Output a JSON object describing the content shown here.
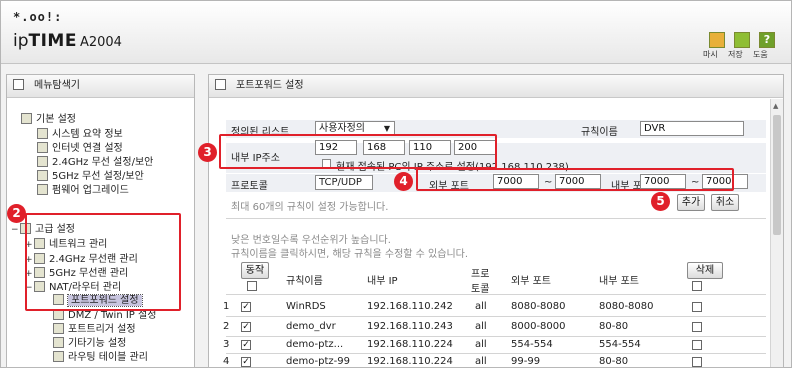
{
  "header": {
    "logo_dots": "*.oo!:",
    "brand_ip": "ip",
    "brand_time": "TIME",
    "model": "A2004",
    "buttons": [
      {
        "label": "마시"
      },
      {
        "label": "저장"
      },
      {
        "label": "도움"
      }
    ]
  },
  "left_panel": {
    "title": "메뉴탐색기",
    "groups": {
      "basic": {
        "label": "기본 설정",
        "items": [
          "시스템 요약 정보",
          "인터넷 연결 설정",
          "2.4GHz 무선 설정/보안",
          "5GHz 무선 설정/보안",
          "펌웨어 업그레이드"
        ]
      },
      "advanced": {
        "label": "고급 설정",
        "items": [
          "네트워크 관리",
          "2.4GHz 무선랜 관리",
          "5GHz 무선랜 관리",
          "NAT/라우터 관리"
        ]
      },
      "nat_items": [
        "포트포워드 설정",
        "DMZ / Twin IP 설정",
        "포트트리거 설정",
        "기타기능 설정",
        "라우팅 테이블 관리"
      ]
    }
  },
  "right_panel": {
    "title": "포트포워드 설정",
    "form": {
      "defined_rule_label": "정의된 리스트",
      "defined_rule_value": "사용자정의",
      "rule_name_label": "규칙이름",
      "rule_name_value": "DVR",
      "internal_ip_label": "내부 IP주소",
      "ip": [
        "192",
        "168",
        "110",
        "200"
      ],
      "current_pc_text": "현재 접속된 PC의 IP 주소로 설정(192.168.110.238)",
      "protocol_label": "프로토콜",
      "protocol_value": "TCP/UDP",
      "ext_port_label": "외부 포트",
      "ext_port_from": "7000",
      "ext_port_to": "7000",
      "int_port_label": "내부 포트",
      "int_port_from": "7000",
      "int_port_to": "7000",
      "tilde": "~",
      "max_rules_note": "최대 60개의 규칙이 설정 가능합니다.",
      "add_button": "추가",
      "cancel_button": "취소"
    },
    "notes": [
      "낮은 번호일수록 우선순위가 높습니다.",
      "규칙이름을 클릭하시면, 해당 규칙을 수정할 수 있습니다."
    ],
    "table": {
      "action_button": "동작",
      "delete_button": "삭제",
      "headers": [
        "규칙이름",
        "내부 IP",
        "프로\n토콜",
        "외부 포트",
        "내부 포트"
      ],
      "protocol_header_line1": "프로",
      "protocol_header_line2": "토콜",
      "rows": [
        {
          "no": "1",
          "name": "WinRDS",
          "ip": "192.168.110.242",
          "proto": "all",
          "ext": "8080-8080",
          "int": "8080-8080"
        },
        {
          "no": "2",
          "name": "demo_dvr",
          "ip": "192.168.110.243",
          "proto": "all",
          "ext": "8000-8000",
          "int": "80-80"
        },
        {
          "no": "3",
          "name": "demo-ptz...",
          "ip": "192.168.110.224",
          "proto": "all",
          "ext": "554-554",
          "int": "554-554"
        },
        {
          "no": "4",
          "name": "demo-ptz-99",
          "ip": "192.168.110.224",
          "proto": "all",
          "ext": "99-99",
          "int": "80-80"
        }
      ]
    }
  },
  "annotations": [
    "2",
    "3",
    "4",
    "5"
  ],
  "colors": {
    "annotation_red": "#e0202a",
    "form_row_bg": "#eef0f4",
    "selected_bg": "#c9c6e0"
  }
}
